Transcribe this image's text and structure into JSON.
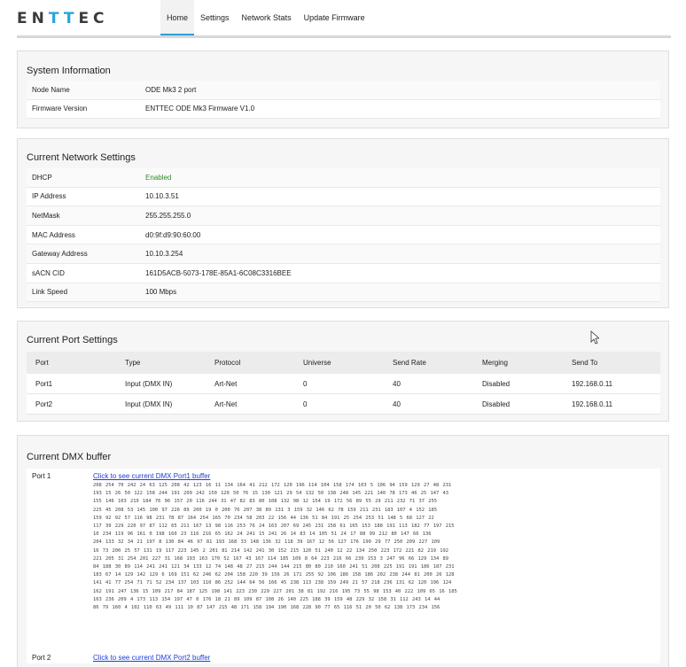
{
  "header": {
    "logo_left": "EN",
    "logo_accent": "TT",
    "logo_right": "EC",
    "nav": [
      "Home",
      "Settings",
      "Network Stats",
      "Update Firmware"
    ],
    "accent_color": "#2aa1d9"
  },
  "system_info": {
    "title": "System Information",
    "rows": [
      {
        "key": "Node Name",
        "value": "ODE Mk3 2 port"
      },
      {
        "key": "Firmware Version",
        "value": "ENTTEC ODE Mk3 Firmware V1.0"
      }
    ]
  },
  "network": {
    "title": "Current Network Settings",
    "rows": [
      {
        "key": "DHCP",
        "value": "Enabled"
      },
      {
        "key": "IP Address",
        "value": "10.10.3.51"
      },
      {
        "key": "NetMask",
        "value": "255.255.255.0"
      },
      {
        "key": "MAC Address",
        "value": "d0:9f:d9:90:60:00"
      },
      {
        "key": "Gateway Address",
        "value": "10.10.3.254"
      },
      {
        "key": "sACN CID",
        "value": "161D5ACB-5073-178E-85A1-6C08C3316BEE"
      },
      {
        "key": "Link Speed",
        "value": "100 Mbps"
      }
    ]
  },
  "ports": {
    "title": "Current Port Settings",
    "headers": [
      "Port",
      "Type",
      "Protocol",
      "Universe",
      "Send Rate",
      "Merging",
      "Send To"
    ],
    "rows": [
      [
        "Port1",
        "Input (DMX IN)",
        "Art-Net",
        "0",
        "40",
        "Disabled",
        "192.168.0.11"
      ],
      [
        "Port2",
        "Input (DMX IN)",
        "Art-Net",
        "0",
        "40",
        "Disabled",
        "192.168.0.11"
      ]
    ]
  },
  "dmx": {
    "title": "Current DMX buffer",
    "port1_label": "Port 1",
    "port1_link": "Click to see current DMX Port1 buffer",
    "port2_label": "Port 2",
    "port2_link": "Click to see current DMX Port2 buffer",
    "port1_values": [
      "208 254 70 242 24 63 125 208 42 123 16 11 134 164 41 212 172 120 196 114 104 158 174 103 5 106 94 159 129 27 48 231",
      "193 15 26 50 122 158 244 191 209 242 150 120 50 76 15 130 121 29 54 132 50 138 248 145 221 140 78 173 46 25 147 43",
      "155 146 103 219 184 76 96 157 20 116 244 31 47 82 83 80 108 132 98 12 154 19 172 56 89 55 29 211 232 71 37 255",
      "225 45 208 53 145 100 97 226 89 200 19 0 200 76 207 38 89 131 3 159 32 146 62 78 159 211 231 183 107 4 152 185",
      "159 92 92 57 116 98 231 78 87 164 254 165 70 234 58 203 22 156 44 136 51 84 191 25 254 253 51 148 5 68 127 22",
      "117 39 229 220 97 87 112 65 211 167 13 98 116 253 76 24 163 207 69 245 231 158 61 165 153 188 191 113 182 77 197 215",
      "10 234 119 96 161 0 198 160 23 116 216 65 162 24 241 15 241 26 14 83 14 105 51 24 17 88 99 212 80 147 66 136",
      "204 133 32 34 21 197 8 130 84 46 97 81 193 168 33 148 136 32 118 39 167 12 56 127 176 190 29 77 250 209 227 109",
      "16 73 200 25 57 131 19 117 223 145 2 201 81 214 142 241 30 152 215 120 51 240 12 22 134 250 223 172 221 82 219 192",
      "221 205 31 254 201 227 31 168 193 163 170 52 167 43 167 114 185 109 8 64 223 216 66 239 153 3 247 96 66 129 134 89",
      "84 188 30 89 114 241 241 121 34 133 12 74 148 48 27 215 244 144 215 80 80 210 160 241 51 208 225 191 191 186 187 231",
      "183 67 14 129 142 129 6 169 151 62 246 62 204 158 220 39 156 26 171 255 92 106 186 158 186 202 238 244 81 200 26 128",
      "141 41 77 254 71 71 52 234 137 103 110 86 252 144 64 56 166 45 238 113 238 159 249 21 57 218 236 131 62 120 196 124",
      "162 191 247 136 15 109 217 84 187 125 198 141 223 230 229 227 201 38 81 192 216 195 73 55 98 153 40 222 109 65 16 185",
      "163 236 209 4 173 113 154 197 47 0 176 18 21 89 109 87 108 26 140 225 188 39 159 48 229 32 158 31 112 243 14 44",
      "86 79 160 4 102 110 63 49 111 10 87 147 215 48 171 158 194 190 168 228 90 77 65 116 51 20 50 62 138 173 234 156"
    ]
  }
}
